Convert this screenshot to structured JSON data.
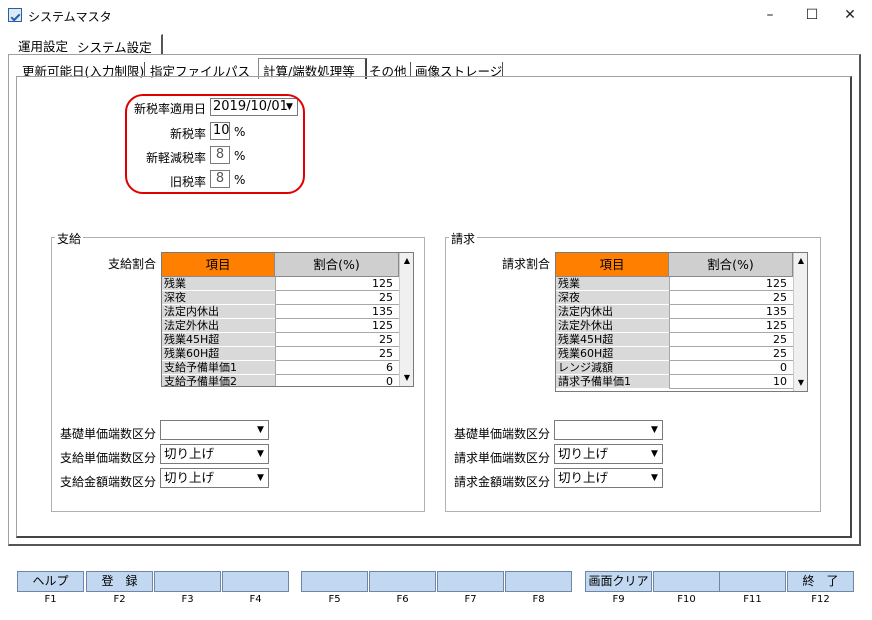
{
  "window": {
    "title": "システムマスタ",
    "controls": {
      "minimize": "–",
      "maximize": "☐",
      "close": "✕"
    }
  },
  "tabs_main": [
    "運用設定",
    "システム設定"
  ],
  "tabs_sub": [
    "更新可能日(入力制限)",
    "指定ファイルパス",
    "計算/端数処理等",
    "その他",
    "画像ストレージ"
  ],
  "tax": {
    "new_rate_date_label": "新税率適用日",
    "new_rate_date_value": "2019/10/01",
    "new_rate_label": "新税率",
    "new_rate_value": "10",
    "new_reduced_label": "新軽減税率",
    "new_reduced_value": "8",
    "old_rate_label": "旧税率",
    "old_rate_value": "8",
    "percent": "%"
  },
  "supply": {
    "group_title": "支給",
    "ratio_label": "支給割合",
    "col_item": "項目",
    "col_ratio": "割合(%)",
    "rows": [
      {
        "name": "残業",
        "value": "125"
      },
      {
        "name": "深夜",
        "value": "25"
      },
      {
        "name": "法定内休出",
        "value": "135"
      },
      {
        "name": "法定外休出",
        "value": "125"
      },
      {
        "name": "残業45H超",
        "value": "25"
      },
      {
        "name": "残業60H超",
        "value": "25"
      },
      {
        "name": "支給予備単価1",
        "value": "6"
      },
      {
        "name": "支給予備単価2",
        "value": "0"
      }
    ],
    "base_round_label": "基礎単価端数区分",
    "base_round_value": "",
    "unit_round_label": "支給単価端数区分",
    "unit_round_value": "切り上げ",
    "amount_round_label": "支給金額端数区分",
    "amount_round_value": "切り上げ"
  },
  "billing": {
    "group_title": "請求",
    "ratio_label": "請求割合",
    "col_item": "項目",
    "col_ratio": "割合(%)",
    "rows": [
      {
        "name": "残業",
        "value": "125"
      },
      {
        "name": "深夜",
        "value": "25"
      },
      {
        "name": "法定内休出",
        "value": "135"
      },
      {
        "name": "法定外休出",
        "value": "125"
      },
      {
        "name": "残業45H超",
        "value": "25"
      },
      {
        "name": "残業60H超",
        "value": "25"
      },
      {
        "name": "レンジ減額",
        "value": "0"
      },
      {
        "name": "請求予備単価1",
        "value": "10"
      }
    ],
    "base_round_label": "基礎単価端数区分",
    "base_round_value": "",
    "unit_round_label": "請求単価端数区分",
    "unit_round_value": "切り上げ",
    "amount_round_label": "請求金額端数区分",
    "amount_round_value": "切り上げ"
  },
  "fkeys": [
    {
      "label": "ヘルプ",
      "key": "F1"
    },
    {
      "label": "登　録",
      "key": "F2"
    },
    {
      "label": "",
      "key": "F3"
    },
    {
      "label": "",
      "key": "F4"
    },
    {
      "label": "",
      "key": "F5"
    },
    {
      "label": "",
      "key": "F6"
    },
    {
      "label": "",
      "key": "F7"
    },
    {
      "label": "",
      "key": "F8"
    },
    {
      "label": "画面クリア",
      "key": "F9"
    },
    {
      "label": "",
      "key": "F10"
    },
    {
      "label": "",
      "key": "F11"
    },
    {
      "label": "終　了",
      "key": "F12"
    }
  ],
  "colors": {
    "header_item": "#ff8000",
    "highlight": "#e10000",
    "fkey_bg": "#c2d8f0"
  }
}
